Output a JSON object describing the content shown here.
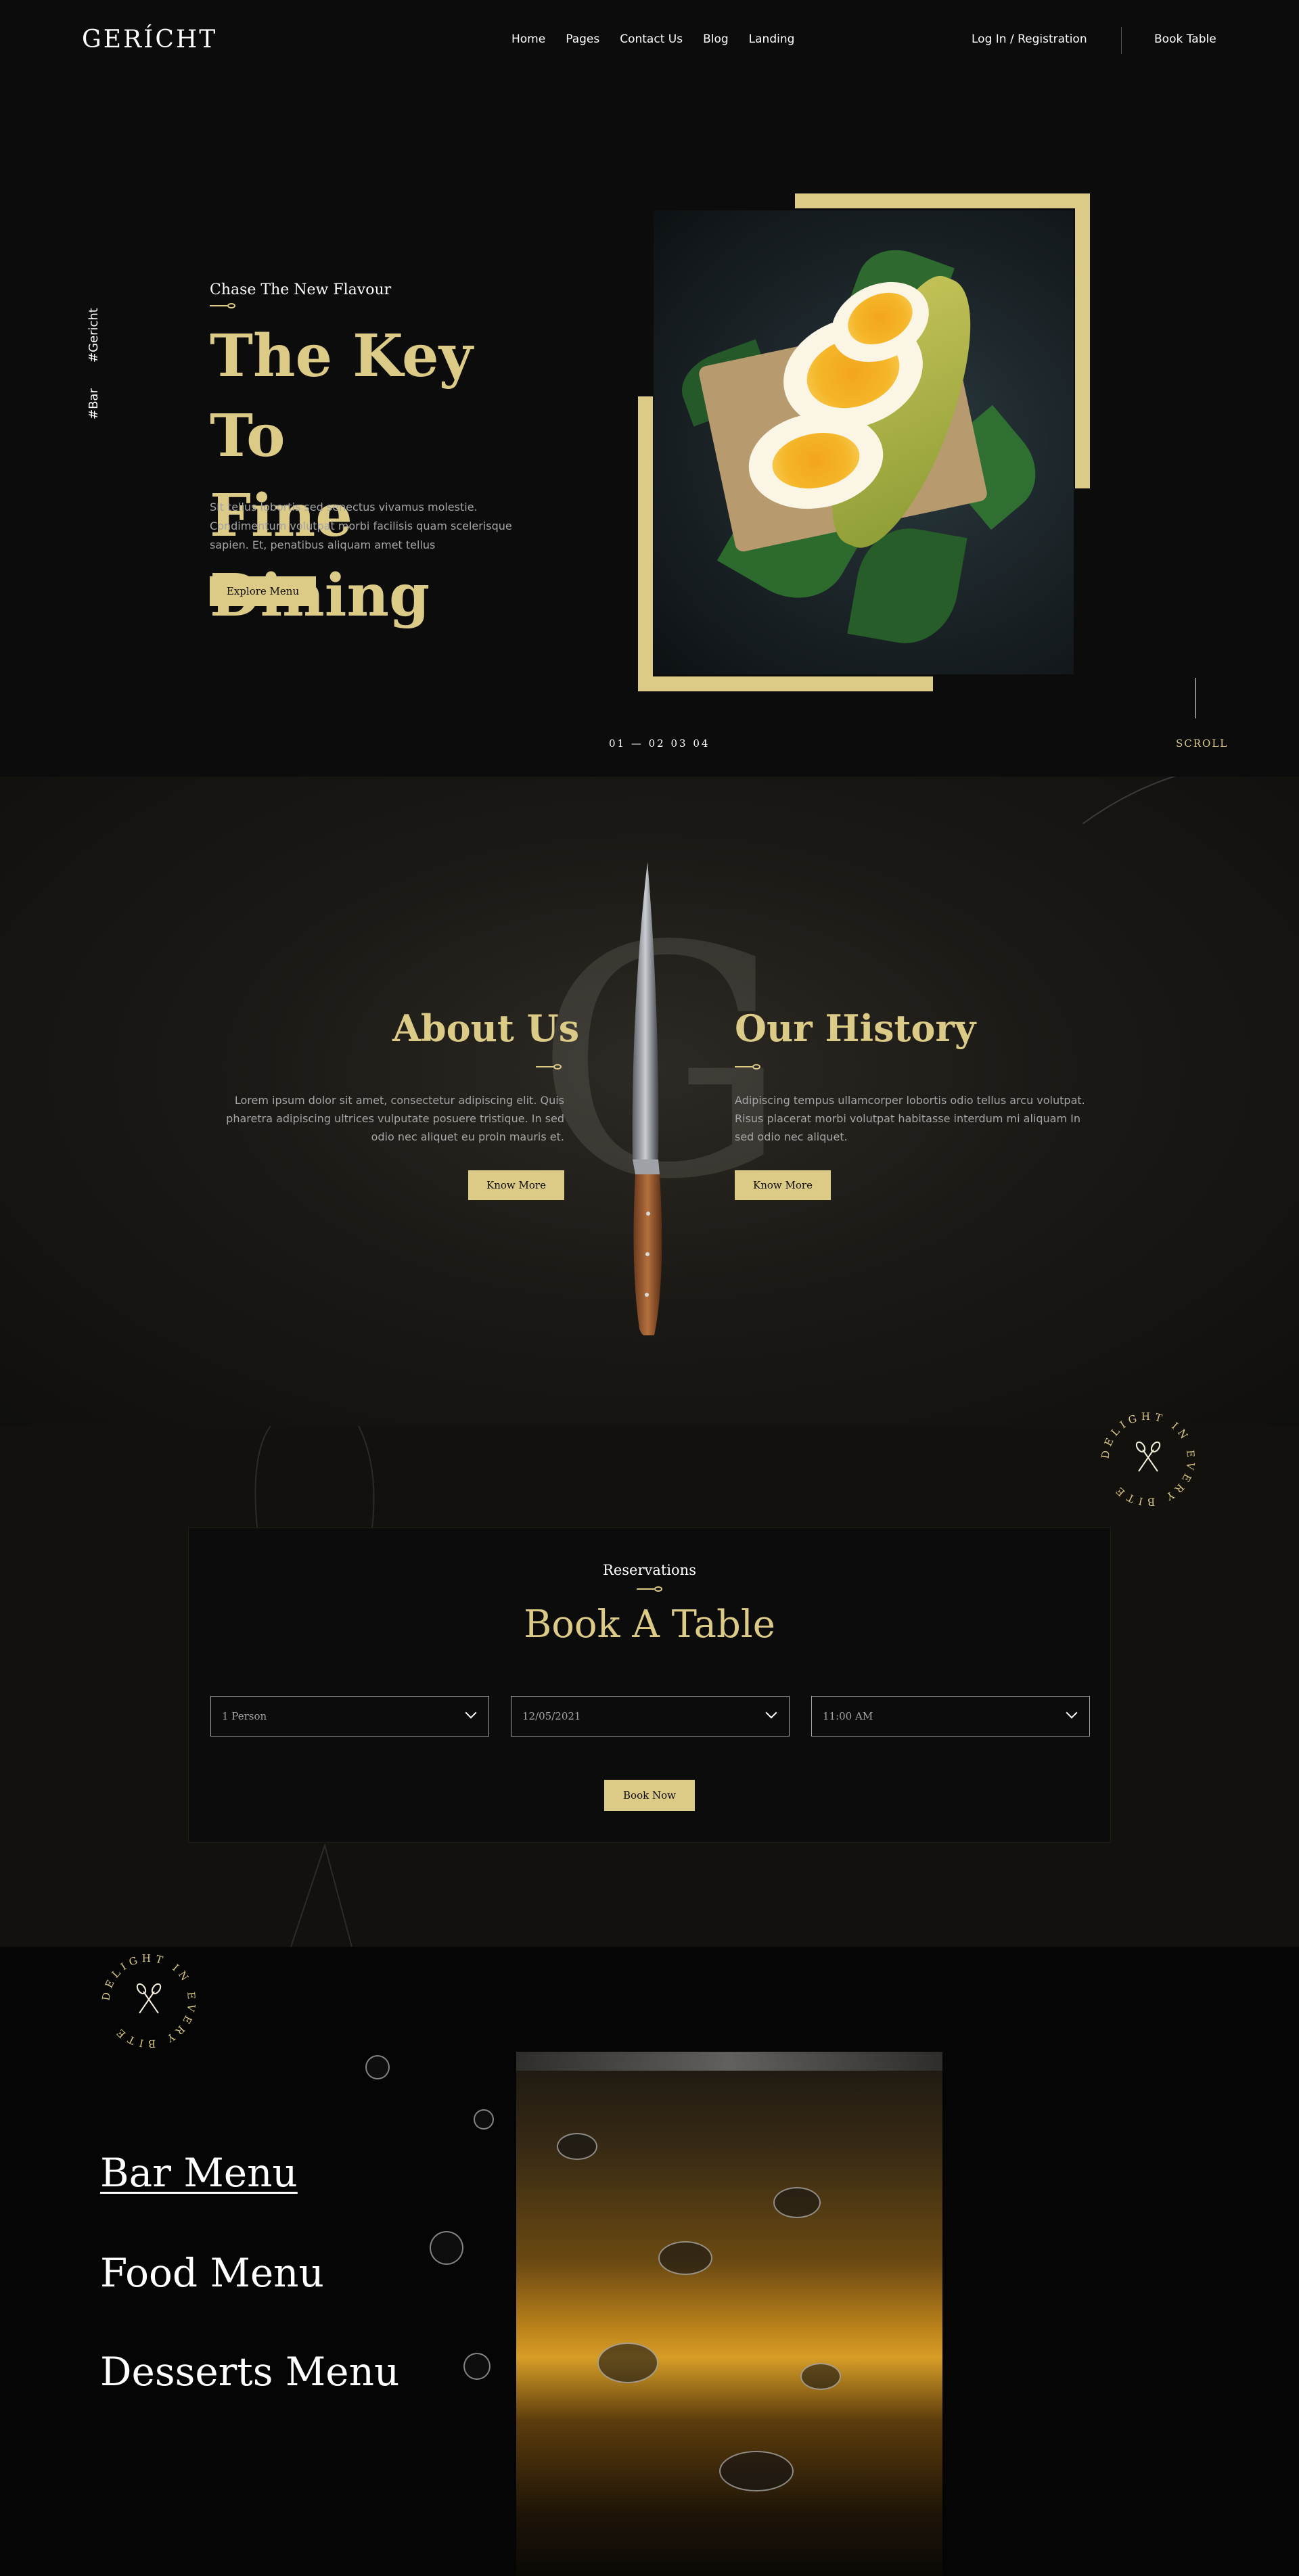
{
  "nav": {
    "logo": "GERÍCHT",
    "links": [
      "Home",
      "Pages",
      "Contact Us",
      "Blog",
      "Landing"
    ],
    "login": "Log In / Registration",
    "book": "Book Table"
  },
  "hero": {
    "tags": [
      "#Bar",
      "#Gericht"
    ],
    "subtitle": "Chase The New Flavour",
    "title_line1": "The Key To",
    "title_line2": "Fine Dining",
    "description": "Sit tellus lobortis sed senectus vivamus molestie. Condimentum volutpat morbi facilisis quam scelerisque sapien. Et, penatibus aliquam amet tellus",
    "cta": "Explore Menu",
    "slides": "01 — 02 03 04",
    "scroll": "SCROLL"
  },
  "about": {
    "bg_letter": "G",
    "about_title": "About Us",
    "about_text": "Lorem ipsum dolor sit amet, consectetur adipiscing elit. Quis pharetra adipiscing ultrices vulputate posuere tristique. In sed odio nec aliquet eu proin mauris et.",
    "about_btn": "Know More",
    "history_title": "Our History",
    "history_text": "Adipiscing tempus ullamcorper lobortis odio tellus arcu volutpat. Risus placerat morbi volutpat habitasse interdum mi aliquam In sed odio nec aliquet.",
    "history_btn": "Know More"
  },
  "badge": {
    "text": "DELIGHT IN EVERY BITE"
  },
  "reservation": {
    "subtitle": "Reservations",
    "title": "Book A Table",
    "persons": "1 Person",
    "date": "12/05/2021",
    "time": "11:00 AM",
    "button": "Book Now"
  },
  "menu": {
    "items": [
      "Bar Menu",
      "Food Menu",
      "Desserts Menu"
    ]
  },
  "colors": {
    "gold": "#dcca87",
    "black": "#0c0c0c",
    "grey": "#a5a5a5"
  }
}
